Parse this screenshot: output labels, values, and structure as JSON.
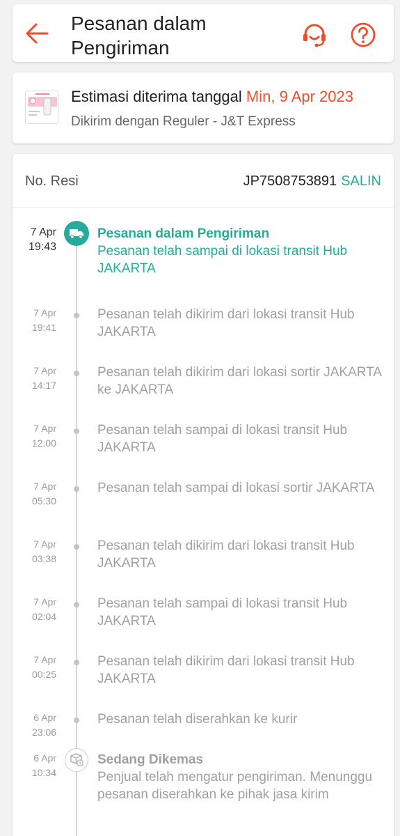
{
  "header": {
    "title": "Pesanan dalam Pengiriman"
  },
  "estimate": {
    "label": "Estimasi diterima tanggal",
    "date": "Min, 9 Apr 2023",
    "shipping": "Dikirim dengan Reguler - J&T Express"
  },
  "resi": {
    "label": "No. Resi",
    "number": "JP7508753891",
    "copy": "SALIN"
  },
  "events": [
    {
      "date": "7 Apr",
      "time": "19:43",
      "title": "Pesanan dalam Pengiriman",
      "text": "Pesanan telah sampai di lokasi transit Hub JAKARTA"
    },
    {
      "date": "7 Apr",
      "time": "19:41",
      "text": "Pesanan telah dikirim dari lokasi transit Hub JAKARTA"
    },
    {
      "date": "7 Apr",
      "time": "14:17",
      "text": "Pesanan telah dikirim dari lokasi sortir JAKARTA ke JAKARTA"
    },
    {
      "date": "7 Apr",
      "time": "12:00",
      "text": "Pesanan telah sampai di lokasi transit Hub JAKARTA"
    },
    {
      "date": "7 Apr",
      "time": "05:30",
      "text": "Pesanan telah sampai di lokasi sortir JAKARTA"
    },
    {
      "date": "7 Apr",
      "time": "03:38",
      "text": "Pesanan telah dikirim dari lokasi transit Hub JAKARTA"
    },
    {
      "date": "7 Apr",
      "time": "02:04",
      "text": "Pesanan telah sampai di lokasi transit Hub JAKARTA"
    },
    {
      "date": "7 Apr",
      "time": "00:25",
      "text": "Pesanan telah dikirim dari lokasi transit Hub JAKARTA"
    },
    {
      "date": "6 Apr",
      "time": "23:06",
      "text": "Pesanan telah diserahkan ke kurir"
    },
    {
      "date": "6 Apr",
      "time": "10:34",
      "title": "Sedang Dikemas",
      "text": "Penjual telah mengatur pengiriman. Menunggu pesanan diserahkan ke pihak jasa kirim"
    }
  ],
  "colors": {
    "accent": "#ee4d2d",
    "teal": "#26aa99"
  },
  "icons": {
    "back": "arrow-left-icon",
    "support": "headset-icon",
    "help": "question-icon",
    "truck": "truck-icon",
    "package": "package-icon"
  }
}
